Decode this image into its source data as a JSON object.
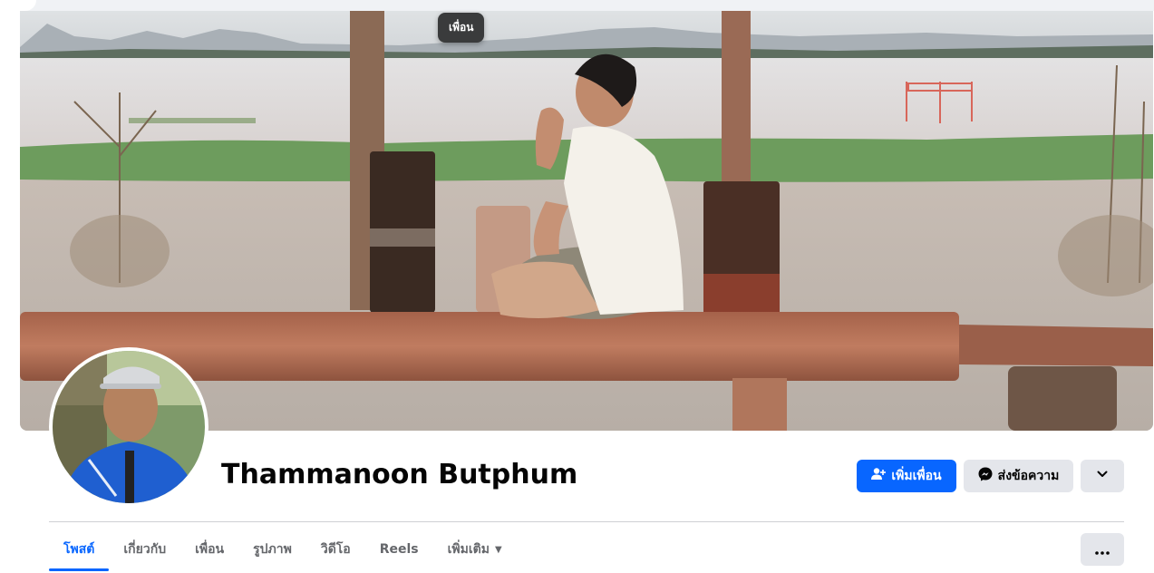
{
  "tooltip": {
    "text": "เพื่อน"
  },
  "profile": {
    "name": "Thammanoon Butphum"
  },
  "actions": {
    "add_friend": {
      "label": "เพิ่มเพื่อน",
      "icon": "add-friend-icon"
    },
    "message": {
      "label": "ส่งข้อความ",
      "icon": "messenger-icon"
    },
    "more": {
      "icon": "chevron-down-icon"
    }
  },
  "tabs": [
    {
      "label": "โพสต์",
      "active": true
    },
    {
      "label": "เกี่ยวกับ",
      "active": false
    },
    {
      "label": "เพื่อน",
      "active": false
    },
    {
      "label": "รูปภาพ",
      "active": false
    },
    {
      "label": "วิดีโอ",
      "active": false
    },
    {
      "label": "Reels",
      "active": false
    },
    {
      "label": "เพิ่มเติม",
      "active": false,
      "dropdown": true
    }
  ],
  "overflow_menu": {
    "icon": "more-dots-icon"
  },
  "colors": {
    "accent": "#0866ff",
    "secondary_button": "#e4e6eb",
    "text": "#050505",
    "muted_text": "#65676b"
  }
}
